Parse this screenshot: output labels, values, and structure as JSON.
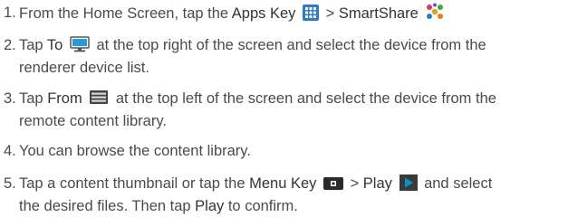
{
  "steps": [
    {
      "num": "1.",
      "lead": "From the Home Screen, tap the ",
      "apps_key": "Apps Key",
      "sep": " > ",
      "smartshare": "SmartShare",
      "icons": [
        "apps-grid-icon",
        "smartshare-icon"
      ]
    },
    {
      "num": "2.",
      "lead": "Tap ",
      "to": "To",
      "line1_rest": " at the top right of the screen and select the device from the",
      "line2": "renderer device list.",
      "icons": [
        "monitor-icon"
      ]
    },
    {
      "num": "3.",
      "lead": "Tap ",
      "from": "From",
      "line1_rest": " at the top left of the screen and select the device from the",
      "line2": "remote content library.",
      "icons": [
        "library-icon"
      ]
    },
    {
      "num": "4.",
      "text": "You can browse the content library."
    },
    {
      "num": "5.",
      "lead": "Tap a content thumbnail or tap the ",
      "menu_key": "Menu Key",
      "sep": " > ",
      "play": "Play",
      "line1_rest": " and select",
      "line2_a": "the desired files. Then tap ",
      "play2": "Play",
      "line2_b": " to confirm.",
      "icons": [
        "menu-key-icon",
        "play-icon"
      ]
    }
  ],
  "colors": {
    "text": "#4a4a4a",
    "apps_icon": "#2e7cc4",
    "monitor_icon": "#2a9bd6",
    "play_icon": "#0b8fcf"
  }
}
